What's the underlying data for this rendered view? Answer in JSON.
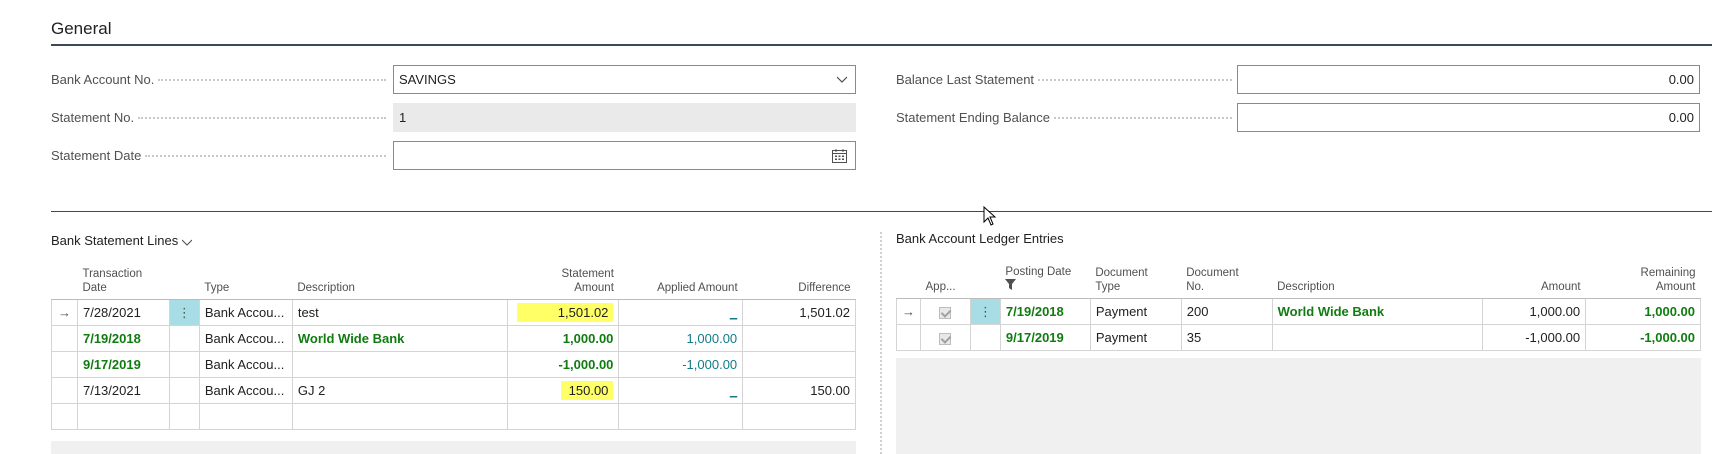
{
  "general": {
    "title": "General",
    "fields": {
      "bank_account_no": {
        "label": "Bank Account No.",
        "value": "SAVINGS"
      },
      "statement_no": {
        "label": "Statement No.",
        "value": "1"
      },
      "statement_date": {
        "label": "Statement Date",
        "value": ""
      },
      "balance_last_statement": {
        "label": "Balance Last Statement",
        "value": "0.00"
      },
      "statement_ending_balance": {
        "label": "Statement Ending Balance",
        "value": "0.00"
      }
    }
  },
  "bank_statement_lines": {
    "title": "Bank Statement Lines",
    "columns": {
      "transaction_date_1": "Transaction",
      "transaction_date_2": "Date",
      "type": "Type",
      "description": "Description",
      "statement_amount_1": "Statement",
      "statement_amount_2": "Amount",
      "applied_amount": "Applied Amount",
      "difference": "Difference"
    },
    "rows": [
      {
        "date": "7/28/2021",
        "type": "Bank Accou...",
        "description": "test",
        "statement_amount": "1,501.02",
        "applied_amount": "_",
        "difference": "1,501.02"
      },
      {
        "date": "7/19/2018",
        "type": "Bank Accou...",
        "description": "World Wide Bank",
        "statement_amount": "1,000.00",
        "applied_amount": "1,000.00",
        "difference": ""
      },
      {
        "date": "9/17/2019",
        "type": "Bank Accou...",
        "description": "",
        "statement_amount": "-1,000.00",
        "applied_amount": "-1,000.00",
        "difference": ""
      },
      {
        "date": "7/13/2021",
        "type": "Bank Accou...",
        "description": "GJ 2",
        "statement_amount": "150.00",
        "applied_amount": "_",
        "difference": "150.00"
      }
    ]
  },
  "ledger_entries": {
    "title": "Bank Account Ledger Entries",
    "columns": {
      "applied": "App...",
      "posting_date": "Posting Date",
      "document_type_1": "Document",
      "document_type_2": "Type",
      "document_no_1": "Document",
      "document_no_2": "No.",
      "description": "Description",
      "amount": "Amount",
      "remaining_amount_1": "Remaining",
      "remaining_amount_2": "Amount"
    },
    "rows": [
      {
        "posting_date": "7/19/2018",
        "document_type": "Payment",
        "document_no": "200",
        "description": "World Wide Bank",
        "amount": "1,000.00",
        "remaining_amount": "1,000.00"
      },
      {
        "posting_date": "9/17/2019",
        "document_type": "Payment",
        "document_no": "35",
        "description": "",
        "amount": "-1,000.00",
        "remaining_amount": "-1,000.00"
      }
    ]
  },
  "colors": {
    "green": "#107c10",
    "teal_link": "#0f7c88",
    "highlight": "#ffff66",
    "selected_cell": "#a8dde6"
  },
  "icons": [
    "chevron-down-icon",
    "calendar-icon",
    "row-arrow-icon",
    "more-options-icon",
    "filter-icon",
    "checkbox-icon",
    "mouse-cursor-icon"
  ]
}
